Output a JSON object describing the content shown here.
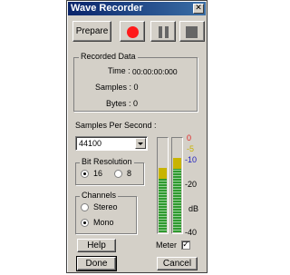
{
  "window": {
    "title": "Wave Recorder",
    "close_glyph": "✕"
  },
  "toolbar": {
    "prepare_label": "Prepare",
    "record_icon": "record-icon",
    "pause_icon": "pause-icon",
    "stop_icon": "stop-icon"
  },
  "recorded": {
    "group_label": "Recorded Data",
    "time_label": "Time :",
    "time_value": "00:00:00:000",
    "samples_label": "Samples : 0",
    "bytes_label": "Bytes : 0"
  },
  "sample_rate": {
    "label": "Samples Per Second :",
    "selected": "44100"
  },
  "bit_resolution": {
    "group_label": "Bit Resolution",
    "options": [
      "16",
      "8"
    ],
    "selected": "16"
  },
  "channels": {
    "group_label": "Channels",
    "options": [
      "Stereo",
      "Mono"
    ],
    "selected": "Mono"
  },
  "meter": {
    "scale": [
      "0",
      "-5",
      "-10",
      "-20",
      "dB",
      "-40"
    ],
    "scale_colors": [
      "#e02020",
      "#c8b400",
      "#2020c0",
      "#000000",
      "#000000",
      "#000000"
    ],
    "left_level": 0.7,
    "right_level": 0.8,
    "label": "Meter",
    "checked_glyph": "✓"
  },
  "buttons": {
    "help": "Help",
    "done": "Done",
    "cancel": "Cancel"
  }
}
